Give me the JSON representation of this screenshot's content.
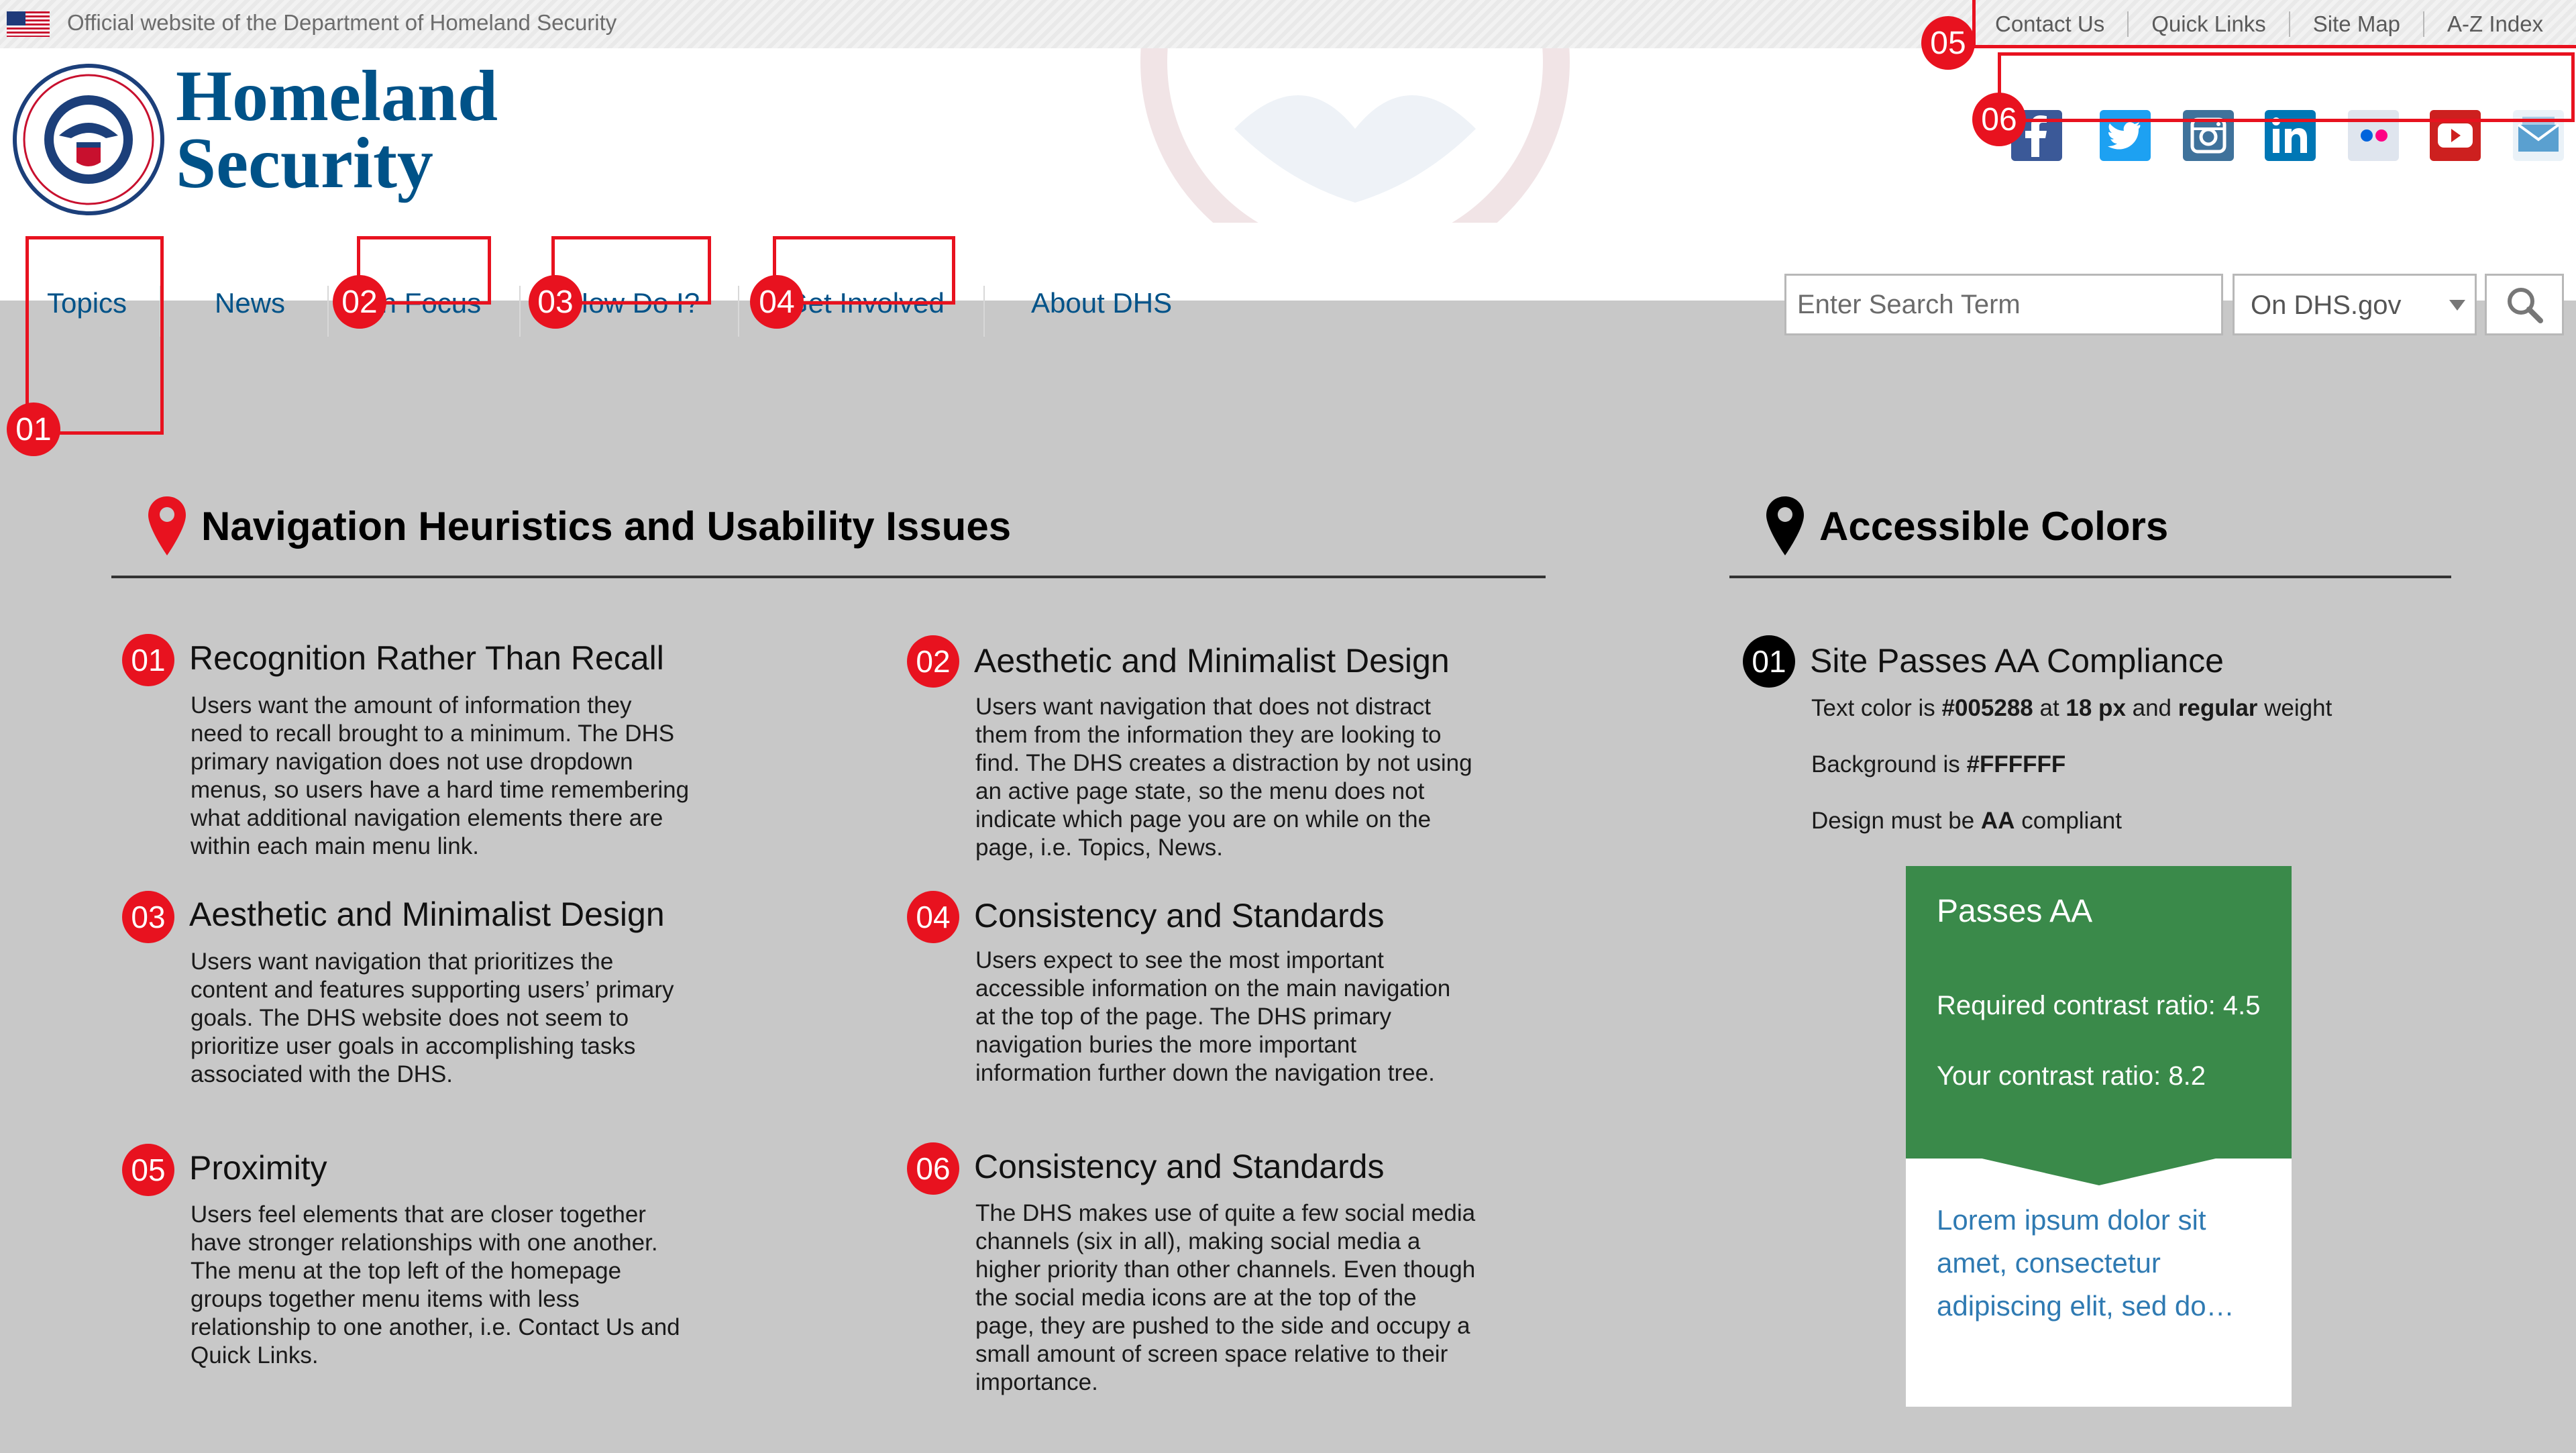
{
  "utility_bar": {
    "official_text": "Official website of the Department of Homeland Security",
    "links": [
      "Contact Us",
      "Quick Links",
      "Site Map",
      "A-Z Index"
    ]
  },
  "brand": {
    "line1": "Homeland",
    "line2": "Security",
    "color": "#005288"
  },
  "social_icons": [
    {
      "name": "facebook-icon",
      "color": "#3b5998"
    },
    {
      "name": "twitter-icon",
      "color": "#1da1f2"
    },
    {
      "name": "instagram-icon",
      "color": "#3f729b"
    },
    {
      "name": "linkedin-icon",
      "color": "#0077b5"
    },
    {
      "name": "flickr-icon",
      "color": "#ff0084"
    },
    {
      "name": "youtube-icon",
      "color": "#cd201f"
    },
    {
      "name": "email-icon",
      "color": "#5aa0d0"
    }
  ],
  "nav": {
    "items": [
      "Topics",
      "News",
      "In Focus",
      "How Do I?",
      "Get Involved",
      "About DHS"
    ]
  },
  "search": {
    "placeholder": "Enter Search Term",
    "scope": "On DHS.gov"
  },
  "annotations": [
    "01",
    "02",
    "03",
    "04",
    "05",
    "06"
  ],
  "heuristics": {
    "title": "Navigation Heuristics and Usability Issues",
    "items": [
      {
        "num": "01",
        "title": "Recognition Rather Than Recall",
        "lines": [
          "Users want the amount of information they",
          "need to recall brought to a minimum. The DHS",
          "primary navigation does not use dropdown",
          "menus, so users have a hard time remembering",
          "what additional navigation elements there are",
          "within each main menu link."
        ]
      },
      {
        "num": "02",
        "title": "Aesthetic and Minimalist Design",
        "lines": [
          "Users want navigation that does not distract",
          "them from the information they are looking to",
          "find. The DHS creates a distraction by not using",
          "an active page state, so the menu does not",
          "indicate which page you are on while on the",
          "page, i.e. Topics, News."
        ]
      },
      {
        "num": "03",
        "title": "Aesthetic and Minimalist Design",
        "lines": [
          "Users want navigation that prioritizes the",
          "content and features supporting users’ primary",
          "goals. The DHS website does not seem to",
          "prioritize user goals in accomplishing tasks",
          "associated with the DHS."
        ]
      },
      {
        "num": "04",
        "title": "Consistency and Standards",
        "lines": [
          "Users expect to see the most important",
          "accessible information on the main navigation",
          "at the top of the page. The DHS primary",
          "navigation buries the more important",
          "information further down the navigation tree."
        ]
      },
      {
        "num": "05",
        "title": "Proximity",
        "lines": [
          "Users feel elements that are closer together",
          "have stronger relationships with one another.",
          "The menu at the top left of the homepage",
          "groups together menu items with less",
          "relationship to one another, i.e. Contact Us and",
          "Quick Links."
        ]
      },
      {
        "num": "06",
        "title": "Consistency and Standards",
        "lines": [
          "The DHS makes use of quite a few social media",
          "channels (six in all), making social media a",
          "higher priority than other channels. Even though",
          "the social media icons are at the top of the",
          "page, they are pushed to the side and occupy a",
          "small amount of screen space relative to their",
          "importance."
        ]
      }
    ]
  },
  "accessible": {
    "title": "Accessible Colors",
    "item": {
      "num": "01",
      "title": "Site Passes AA Compliance",
      "text_color_pre": "Text color is ",
      "text_color_value": "#005288",
      "text_color_mid": " at ",
      "text_size": "18 px",
      "text_color_and": " and ",
      "text_weight": "regular",
      "text_color_post": " weight",
      "background_pre": "Background is ",
      "background_value": "#FFFFFF",
      "design_pre": "Design must be ",
      "design_value": "AA",
      "design_post": " compliant"
    },
    "card": {
      "heading": "Passes AA",
      "required": "Required contrast ratio: 4.5",
      "yours": "Your contrast ratio: 8.2",
      "link_lines": [
        "Lorem ipsum dolor sit",
        "amet, consectetur",
        "adipiscing elit, sed do…"
      ],
      "color": "#3a8a4a"
    }
  }
}
